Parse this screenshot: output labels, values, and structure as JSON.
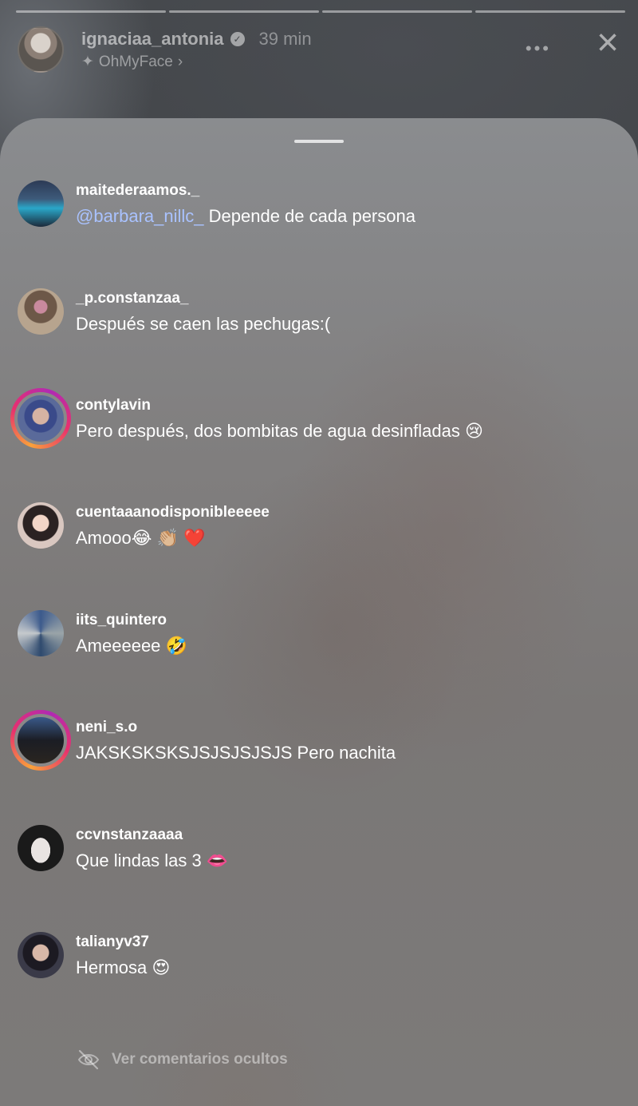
{
  "story": {
    "username": "ignaciaa_antonia",
    "verified_icon": "verified-badge-icon",
    "time": "39 min",
    "effect": "OhMyFace",
    "more_icon": "•••",
    "close_icon": "×"
  },
  "comments": [
    {
      "user": "maitederaamos._",
      "mention": "@barbara_nillc_",
      "text": " Depende de cada persona",
      "ring": false
    },
    {
      "user": "_p.constanzaa_",
      "text": "Después se caen las pechugas:(",
      "ring": false
    },
    {
      "user": "contylavin",
      "text": "Pero después, dos bombitas de agua desinfladas 😢",
      "ring": true
    },
    {
      "user": "cuentaaanodisponibleeeee",
      "text": "Amooo😂 👏🏼 ❤️",
      "ring": false
    },
    {
      "user": "iits_quintero",
      "text": "Ameeeeee 🤣",
      "ring": false
    },
    {
      "user": "neni_s.o",
      "text": "JAKSKSKSKSJSJSJSJSJS Pero nachita",
      "ring": true
    },
    {
      "user": "ccvnstanzaaaa",
      "text": "Que lindas las 3 👄",
      "ring": false
    },
    {
      "user": "talianyv37",
      "text": "Hermosa 😍",
      "ring": false
    }
  ],
  "hidden_comments": {
    "label": "Ver comentarios ocultos",
    "icon": "eye-slash-icon"
  },
  "colors": {
    "mention": "#a9c2ff",
    "story_ring": [
      "#f9a13a",
      "#e8306e",
      "#b02ab4"
    ]
  }
}
